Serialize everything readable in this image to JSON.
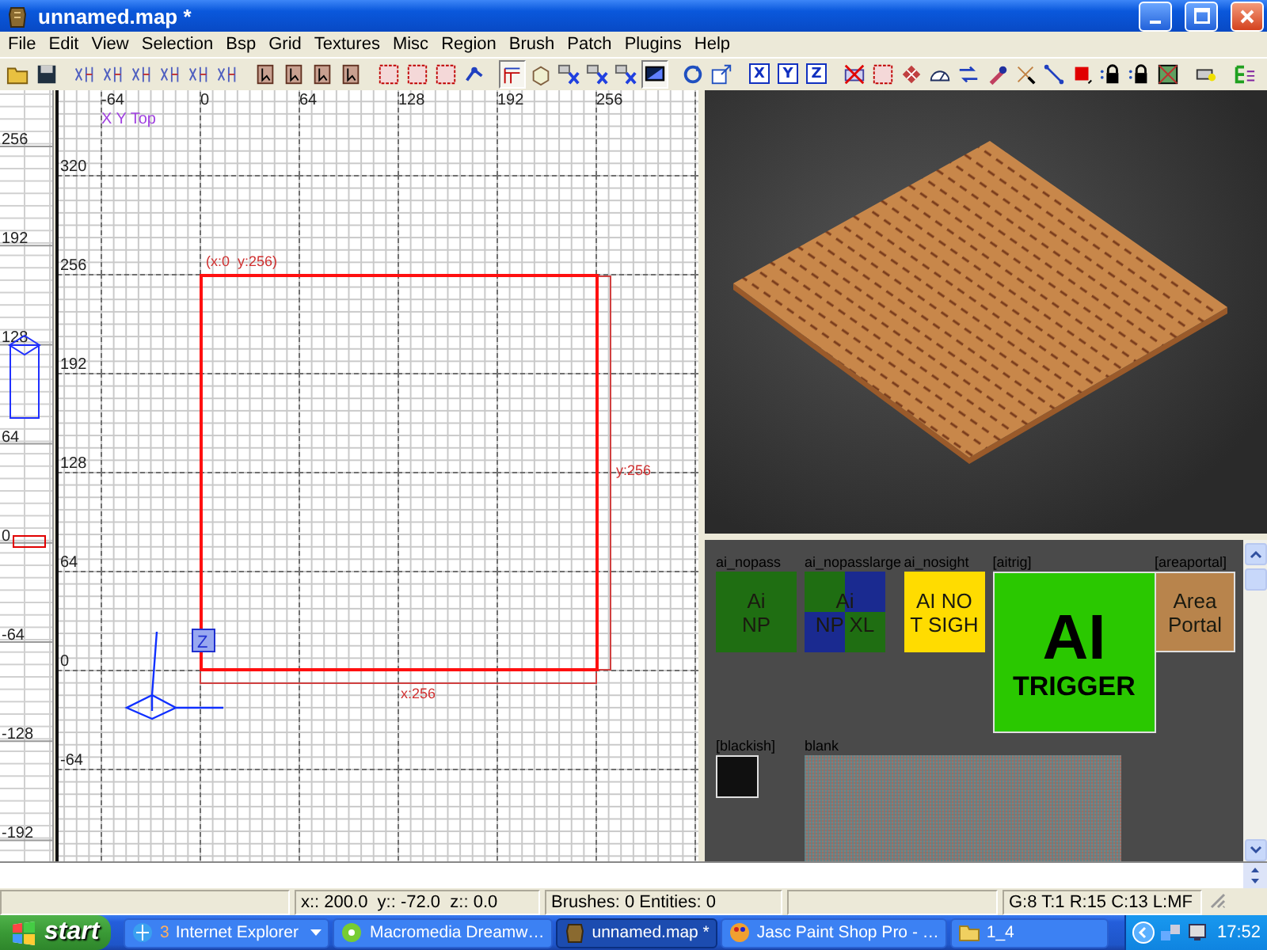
{
  "window": {
    "title": "unnamed.map *"
  },
  "menu": [
    "File",
    "Edit",
    "View",
    "Selection",
    "Bsp",
    "Grid",
    "Textures",
    "Misc",
    "Region",
    "Brush",
    "Patch",
    "Plugins",
    "Help"
  ],
  "toolbar": [
    [
      {
        "selected": false
      },
      {
        "selected": false
      }
    ],
    [
      {
        "selected": false
      },
      {
        "selected": false
      },
      {
        "selected": false
      },
      {
        "selected": false
      },
      {
        "selected": false
      },
      {
        "selected": false
      }
    ],
    [
      {
        "selected": false
      },
      {
        "selected": false
      },
      {
        "selected": false
      },
      {
        "selected": false
      }
    ],
    [
      {
        "selected": false
      },
      {
        "selected": false
      },
      {
        "selected": false
      },
      {
        "selected": false
      }
    ],
    [
      {
        "selected": true
      },
      {
        "selected": false
      },
      {
        "selected": false
      },
      {
        "selected": false
      },
      {
        "selected": false
      },
      {
        "selected": true
      }
    ],
    [
      {
        "selected": false
      },
      {
        "selected": false
      }
    ],
    [
      {
        "label": "X",
        "selected": false
      },
      {
        "label": "Y",
        "selected": false
      },
      {
        "label": "Z",
        "selected": false
      }
    ],
    [
      {
        "selected": false
      },
      {
        "selected": false
      },
      {
        "selected": false
      },
      {
        "selected": false
      },
      {
        "selected": false
      },
      {
        "selected": false
      },
      {
        "selected": false
      },
      {
        "selected": false
      },
      {
        "selected": false
      },
      {
        "selected": false
      },
      {
        "selected": false
      },
      {
        "selected": false
      }
    ],
    [
      {
        "selected": false
      }
    ],
    [
      {
        "selected": false
      }
    ]
  ],
  "z_view": {
    "ticks": [
      "256",
      "192",
      "128",
      "64",
      "0",
      "-64",
      "-128",
      "-192"
    ]
  },
  "xy_view": {
    "view_label": "X Y Top",
    "x_ticks": [
      "-64",
      "0",
      "64",
      "128",
      "192",
      "256"
    ],
    "y_ticks": [
      "320",
      "256",
      "192",
      "128",
      "64",
      "0",
      "-64"
    ],
    "brush_labels": [
      "(x:0  y:256)",
      "y:256",
      "x:256"
    ],
    "z_marker": "Z"
  },
  "texture_browser": {
    "rows": [
      [
        {
          "name": "ai_nopass",
          "kind": "text",
          "color": "#1f6e12",
          "text": [
            "Ai",
            "NP"
          ],
          "framed": false
        },
        {
          "name": "ai_nopasslarge",
          "kind": "split",
          "color": "#1f6e12",
          "text": [
            "Ai",
            "NP XL"
          ],
          "framed": false
        },
        {
          "name": "ai_nosight",
          "kind": "text",
          "color": "#ffdc00",
          "text": [
            "AI NO",
            "T SIGH"
          ],
          "framed": false
        },
        {
          "name": "[aitrig]",
          "kind": "graffiti",
          "color": "#2ac800",
          "text": [
            "AI",
            "TRIGGER"
          ],
          "framed": true
        },
        {
          "name": "[areaportal]",
          "kind": "text",
          "color": "#b8844c",
          "text": [
            "Area",
            "Portal"
          ],
          "framed": true
        }
      ],
      [
        {
          "name": "[blackish]",
          "kind": "swatch",
          "color": "#101010",
          "framed": true
        },
        {
          "name": "blank",
          "kind": "noise",
          "color": "#8a7c78",
          "framed": false
        }
      ]
    ]
  },
  "status_bar": {
    "cells": [
      "x:: 200.0  y:: -72.0  z:: 0.0",
      "Brushes: 0 Entities: 0",
      "G:8 T:1 R:15 C:13 L:MF"
    ]
  },
  "taskbar": {
    "start": "start",
    "tasks": [
      {
        "count": "3",
        "label": "Internet Explorer",
        "selected": false
      },
      {
        "label": "Macromedia Dreamw…",
        "selected": false
      },
      {
        "label": "unnamed.map *",
        "selected": true
      },
      {
        "label": "Jasc Paint Shop Pro - …",
        "selected": false
      },
      {
        "label": "1_4",
        "selected": false
      }
    ],
    "clock": "17:52"
  }
}
